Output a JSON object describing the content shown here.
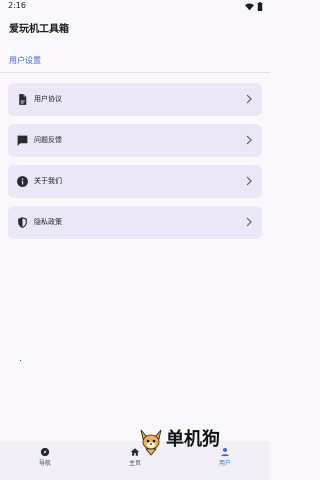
{
  "status_bar": {
    "time": "2:16",
    "icons": [
      "wifi-icon",
      "battery-icon"
    ]
  },
  "app_bar": {
    "title": "爱玩机工具箱"
  },
  "section": {
    "title": "用户设置"
  },
  "menu": {
    "items": [
      {
        "label": "用户协议",
        "icon": "document-icon"
      },
      {
        "label": "问题反馈",
        "icon": "feedback-icon"
      },
      {
        "label": "关于我们",
        "icon": "info-icon"
      },
      {
        "label": "隐私政策",
        "icon": "shield-icon"
      }
    ]
  },
  "bottom_nav": {
    "items": [
      {
        "label": "导航",
        "icon": "compass-icon",
        "active": false
      },
      {
        "label": "主页",
        "icon": "home-icon",
        "active": false
      },
      {
        "label": "用户",
        "icon": "person-icon",
        "active": true
      }
    ]
  },
  "watermark": {
    "text": "单机狗"
  },
  "colors": {
    "accent": "#3f6fd8",
    "card_background": "#ebe7f6",
    "page_background": "#fbf8fd",
    "nav_background": "#f3eff7"
  }
}
